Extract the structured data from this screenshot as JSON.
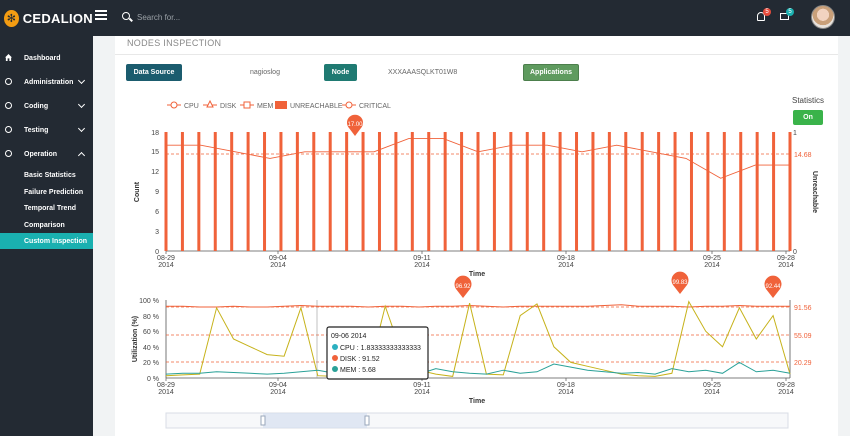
{
  "app": {
    "brand": "CEDALION"
  },
  "search": {
    "placeholder": "Search for..."
  },
  "notifications": {
    "bell_count": "5",
    "mail_count": "5"
  },
  "sidebar": {
    "items": [
      {
        "label": "Dashboard",
        "icon": "home-icon"
      },
      {
        "label": "Administration",
        "icon": "gear-icon"
      },
      {
        "label": "Coding",
        "icon": "gear-icon"
      },
      {
        "label": "Testing",
        "icon": "gear-icon"
      },
      {
        "label": "Operation",
        "icon": "gear-icon"
      }
    ],
    "subitems": [
      {
        "label": "Basic Statistics"
      },
      {
        "label": "Failure Prediction"
      },
      {
        "label": "Temporal Trend"
      },
      {
        "label": "Comparison"
      },
      {
        "label": "Custom Inspection",
        "active": true
      }
    ]
  },
  "panel": {
    "title": "NODES INSPECTION",
    "data_source_label": "Data Source",
    "data_source_value": "nagioslog",
    "node_label": "Node",
    "node_value": "XXXAAASQLKT01W8",
    "applications_label": "Applications",
    "statistics_label": "Statistics",
    "statistics_toggle": "On"
  },
  "colors": {
    "accent": "#1ab0b0",
    "sidebar": "#232a33",
    "series_red": "#f0623a",
    "green": "#3ab34a"
  },
  "chart_data": [
    {
      "type": "bar",
      "legend": [
        "CPU",
        "DISK",
        "MEM",
        "UNREACHABLE",
        "CRITICAL"
      ],
      "xlabel": "Time",
      "ylabel": "Count",
      "y2label": "Unreachable",
      "ylim": [
        0,
        18
      ],
      "y2lim": [
        0,
        1
      ],
      "yticks": [
        "0",
        "3",
        "6",
        "9",
        "12",
        "15",
        "18"
      ],
      "y2ticks": [
        "0",
        "1"
      ],
      "xticks": [
        {
          "date": "08-29",
          "year": "2014"
        },
        {
          "date": "09-04",
          "year": "2014"
        },
        {
          "date": "09-11",
          "year": "2014"
        },
        {
          "date": "09-18",
          "year": "2014"
        },
        {
          "date": "09-25",
          "year": "2014"
        },
        {
          "date": "09-28",
          "year": "2014"
        }
      ],
      "x": [
        "08-29",
        "08-31",
        "09-02",
        "09-04",
        "09-06",
        "09-08",
        "09-10",
        "09-12",
        "09-14",
        "09-16",
        "09-18",
        "09-20",
        "09-22",
        "09-24",
        "09-25",
        "09-26",
        "09-28"
      ],
      "count": [
        16,
        16,
        15,
        14,
        15,
        15,
        15,
        17,
        17,
        15,
        16,
        16,
        15,
        16,
        15,
        14,
        11,
        13,
        13
      ],
      "max_marker": {
        "value": "17.00"
      },
      "mean_line": {
        "value": "14.68"
      },
      "bar_count": 39
    },
    {
      "type": "line",
      "xlabel": "Time",
      "ylabel": "Utilization (%)",
      "ylim": [
        0,
        100
      ],
      "yticks": [
        "0 %",
        "20 %",
        "40 %",
        "60 %",
        "80 %",
        "100 %"
      ],
      "xticks": [
        {
          "date": "08-29",
          "year": "2014"
        },
        {
          "date": "09-04",
          "year": "2014"
        },
        {
          "date": "09-11",
          "year": "2014"
        },
        {
          "date": "09-18",
          "year": "2014"
        },
        {
          "date": "09-25",
          "year": "2014"
        },
        {
          "date": "09-28",
          "year": "2014"
        }
      ],
      "max_markers": [
        "96.92",
        "99.83",
        "92.44"
      ],
      "mean_lines": [
        "91.56",
        "55.09",
        "20.29"
      ],
      "tooltip": {
        "title": "09-06 2014",
        "rows": [
          {
            "label": "CPU : 1.83333333333333",
            "color": "#2bb0c0"
          },
          {
            "label": "DISK : 91.52",
            "color": "#f0623a"
          },
          {
            "label": "MEM : 5.68",
            "color": "#2aa198"
          }
        ]
      }
    }
  ]
}
